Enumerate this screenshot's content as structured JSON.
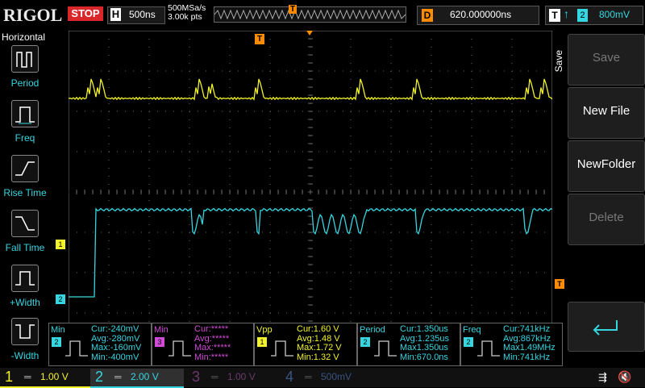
{
  "header": {
    "logo": "RIGOL",
    "run_state": "STOP",
    "timebase_label": "H",
    "timebase": "500ns",
    "sample_rate": "500MSa/s",
    "mem_depth": "3.00k pts",
    "trigger_marker": "T",
    "delay_label": "D",
    "delay": "620.000000ns",
    "trigger_label": "T",
    "trigger_edge": "↑",
    "trigger_source": "2",
    "trigger_level": "800mV"
  },
  "left_menu": {
    "title": "Horizontal",
    "items": [
      {
        "label": "Period",
        "icon": "period-icon"
      },
      {
        "label": "Freq",
        "icon": "freq-icon"
      },
      {
        "label": "Rise Time",
        "icon": "rise-time-icon"
      },
      {
        "label": "Fall Time",
        "icon": "fall-time-icon"
      },
      {
        "label": "+Width",
        "icon": "positive-width-icon"
      },
      {
        "label": "-Width",
        "icon": "negative-width-icon"
      }
    ]
  },
  "right_menu": {
    "title": "Save",
    "buttons": [
      {
        "label": "Save",
        "enabled": false
      },
      {
        "label": "New File",
        "enabled": true
      },
      {
        "label": "NewFolder",
        "enabled": true
      },
      {
        "label": "Delete",
        "enabled": false
      },
      {
        "label": "",
        "icon": "enter-arrow-icon",
        "enabled": true
      }
    ]
  },
  "markers": {
    "ch1": "1",
    "ch2": "2",
    "trigger_level": "T",
    "trigger_pos": "T"
  },
  "measurements": [
    {
      "name": "Min",
      "channel": "2",
      "color": "#36d6e0",
      "cur": "Cur:-240mV",
      "avg": "Avg:-280mV",
      "max": "Max:-160mV",
      "min": "Min:-400mV"
    },
    {
      "name": "Min",
      "channel": "3",
      "color": "#d04bd6",
      "cur": "Cur:*****",
      "avg": "Avg:*****",
      "max": "Max:*****",
      "min": "Min:*****"
    },
    {
      "name": "Vpp",
      "channel": "1",
      "color": "#f2f22a",
      "cur": "Cur:1.60 V",
      "avg": "Avg:1.48 V",
      "max": "Max:1.72 V",
      "min": "Min:1.32 V"
    },
    {
      "name": "Period",
      "channel": "2",
      "color": "#36d6e0",
      "cur": "Cur:1.350us",
      "avg": "Avg:1.235us",
      "max": "Max1.350us",
      "min": "Min:670.0ns"
    },
    {
      "name": "Freq",
      "channel": "2",
      "color": "#36d6e0",
      "cur": "Cur:741kHz",
      "avg": "Avg:867kHz",
      "max": "Max1.49MHz",
      "min": "Min:741kHz"
    }
  ],
  "channels": [
    {
      "num": "1",
      "scale": "1.00 V",
      "color": "#f2f22a",
      "active": true
    },
    {
      "num": "2",
      "scale": "2.00 V",
      "color": "#36d6e0",
      "active": true
    },
    {
      "num": "3",
      "scale": "1.00 V",
      "color": "#d04bd6",
      "active": false
    },
    {
      "num": "4",
      "scale": "500mV",
      "color": "#3c6fd0",
      "active": false
    }
  ],
  "colors": {
    "ch1": "#f2f22a",
    "ch2": "#36d6e0",
    "trigger": "#ff8c00",
    "stop": "#d8262b"
  }
}
